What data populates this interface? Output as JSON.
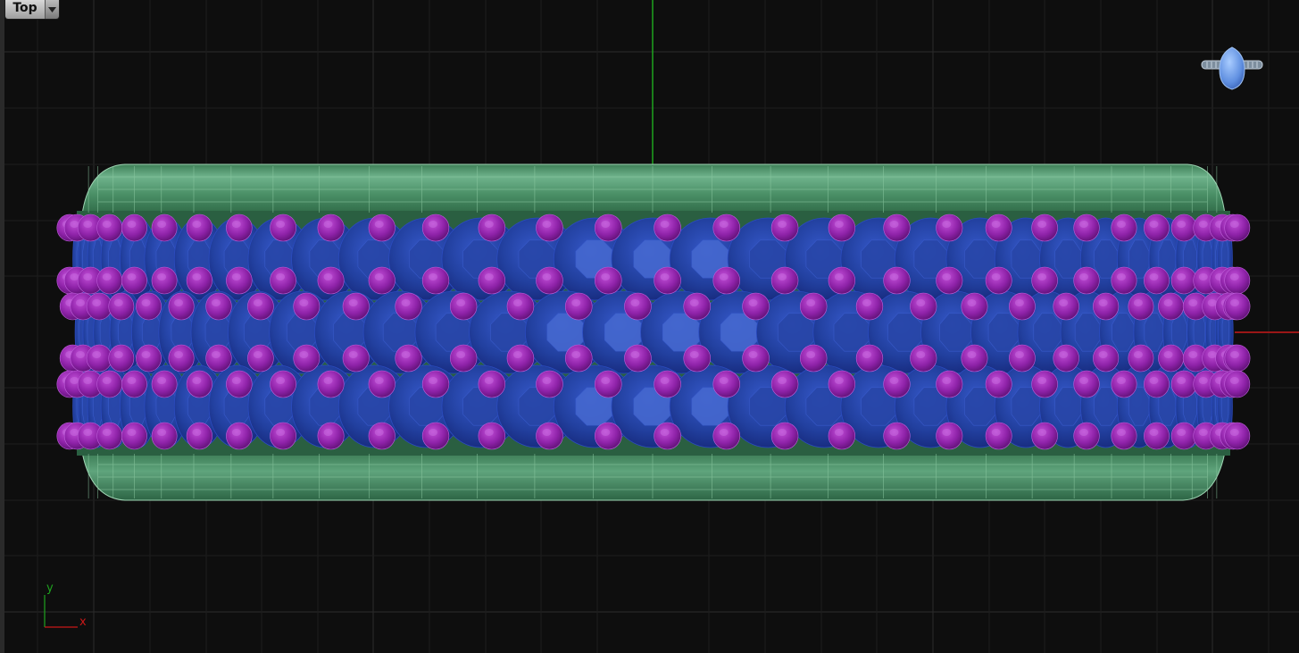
{
  "viewport": {
    "view_name": "Top",
    "view_menu_icon": "chevron-down-icon",
    "axis_x_label": "x",
    "axis_y_label": "y",
    "preview_icon": "ring-preview-icon"
  },
  "colors": {
    "background": "#0e0e0e",
    "grid_line": "#2c2c2c",
    "world_y_axis": "#1fa31f",
    "world_x_axis": "#c81818",
    "band_metal": "#4f9a6e",
    "gem": "#1e3aa0",
    "prong": "#8a23a6"
  }
}
